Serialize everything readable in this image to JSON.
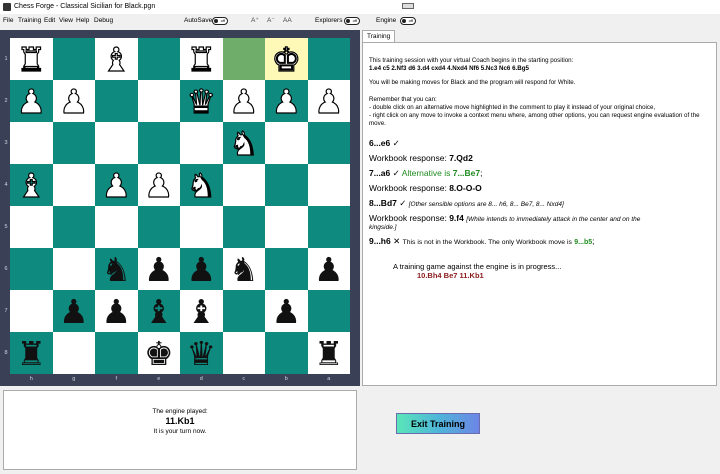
{
  "window": {
    "title": "Chess Forge - Classical Sicilian for Black.pgn"
  },
  "menu": {
    "items": [
      "File",
      "Training",
      "Edit",
      "View",
      "Help",
      "Debug"
    ],
    "autosave_label": "AutoSave",
    "autosave_state": "off",
    "font_buttons": [
      "A⁺",
      "A⁻",
      "AA"
    ],
    "explorers_label": "Explorers",
    "explorers_state": "off",
    "engine_label": "Engine",
    "engine_state": "off"
  },
  "board": {
    "files": [
      "h",
      "g",
      "f",
      "e",
      "d",
      "c",
      "b",
      "a"
    ],
    "ranks": [
      "1",
      "2",
      "3",
      "4",
      "5",
      "6",
      "7",
      "8"
    ],
    "light_color": "#ffffff",
    "dark_color": "#0f8a7e",
    "last_move_from_color": "#6fae6a",
    "last_move_to_color": "#fff9b8",
    "pieces": [
      {
        "file": "h",
        "rank": 1,
        "piece": "rook",
        "color": "white",
        "glyph": "♜"
      },
      {
        "file": "f",
        "rank": 1,
        "piece": "bishop",
        "color": "white",
        "glyph": "♝"
      },
      {
        "file": "d",
        "rank": 1,
        "piece": "rook",
        "color": "white",
        "glyph": "♜"
      },
      {
        "file": "b",
        "rank": 1,
        "piece": "king",
        "color": "white",
        "glyph": "♚"
      },
      {
        "file": "h",
        "rank": 2,
        "piece": "pawn",
        "color": "white",
        "glyph": "♟"
      },
      {
        "file": "g",
        "rank": 2,
        "piece": "pawn",
        "color": "white",
        "glyph": "♟"
      },
      {
        "file": "d",
        "rank": 2,
        "piece": "queen",
        "color": "white",
        "glyph": "♛"
      },
      {
        "file": "c",
        "rank": 2,
        "piece": "pawn",
        "color": "white",
        "glyph": "♟"
      },
      {
        "file": "b",
        "rank": 2,
        "piece": "pawn",
        "color": "white",
        "glyph": "♟"
      },
      {
        "file": "a",
        "rank": 2,
        "piece": "pawn",
        "color": "white",
        "glyph": "♟"
      },
      {
        "file": "c",
        "rank": 3,
        "piece": "knight",
        "color": "white",
        "glyph": "♞"
      },
      {
        "file": "h",
        "rank": 4,
        "piece": "bishop",
        "color": "white",
        "glyph": "♝"
      },
      {
        "file": "f",
        "rank": 4,
        "piece": "pawn",
        "color": "white",
        "glyph": "♟"
      },
      {
        "file": "e",
        "rank": 4,
        "piece": "pawn",
        "color": "white",
        "glyph": "♟"
      },
      {
        "file": "d",
        "rank": 4,
        "piece": "knight",
        "color": "white",
        "glyph": "♞"
      },
      {
        "file": "f",
        "rank": 6,
        "piece": "knight",
        "color": "black",
        "glyph": "♞"
      },
      {
        "file": "e",
        "rank": 6,
        "piece": "pawn",
        "color": "black",
        "glyph": "♟"
      },
      {
        "file": "d",
        "rank": 6,
        "piece": "pawn",
        "color": "black",
        "glyph": "♟"
      },
      {
        "file": "c",
        "rank": 6,
        "piece": "knight",
        "color": "black",
        "glyph": "♞"
      },
      {
        "file": "a",
        "rank": 6,
        "piece": "pawn",
        "color": "black",
        "glyph": "♟"
      },
      {
        "file": "g",
        "rank": 7,
        "piece": "pawn",
        "color": "black",
        "glyph": "♟"
      },
      {
        "file": "f",
        "rank": 7,
        "piece": "pawn",
        "color": "black",
        "glyph": "♟"
      },
      {
        "file": "e",
        "rank": 7,
        "piece": "bishop",
        "color": "black",
        "glyph": "♝"
      },
      {
        "file": "d",
        "rank": 7,
        "piece": "bishop",
        "color": "black",
        "glyph": "♝"
      },
      {
        "file": "b",
        "rank": 7,
        "piece": "pawn",
        "color": "black",
        "glyph": "♟"
      },
      {
        "file": "h",
        "rank": 8,
        "piece": "rook",
        "color": "black",
        "glyph": "♜"
      },
      {
        "file": "e",
        "rank": 8,
        "piece": "king",
        "color": "black",
        "glyph": "♚"
      },
      {
        "file": "d",
        "rank": 8,
        "piece": "queen",
        "color": "black",
        "glyph": "♛"
      },
      {
        "file": "a",
        "rank": 8,
        "piece": "rook",
        "color": "black",
        "glyph": "♜"
      }
    ],
    "highlights": [
      {
        "file": "c",
        "rank": 1,
        "type": "from"
      },
      {
        "file": "b",
        "rank": 1,
        "type": "to"
      }
    ]
  },
  "panel": {
    "tab_label": "Training",
    "intro": "This training session with your virtual Coach begins in the starting position:",
    "opening_moves": "1.e4 c5 2.Nf3 d6 3.d4 cxd4 4.Nxd4 Nf6 5.Nc3 Nc6 6.Bg5",
    "play_info": "You will be making moves for Black and the program will respond for White.",
    "remember": "Remember that you can:",
    "tip1": "- double click on an alternative move highlighted in the comment to play it instead of your original choice,",
    "tip2": "- right click on any move to invoke a context menu where, among other options, you can request engine evaluation of the move.",
    "check_mark": "✓",
    "cross_mark": "✕",
    "lines": {
      "m6": "6...e6",
      "wb_label": "Workbook response:",
      "r7": "7.Qd2",
      "m7": "7...a6",
      "alt_text": "Alternative is",
      "alt_move": "7...Be7",
      "semicolon": ";",
      "r8": "8.O-O-O",
      "m8": "8...Bd7",
      "comment8": "[Other sensible options are 8... h6, 8... Be7, 8... Nxd4]",
      "r9": "9.f4",
      "comment9a": "[White intends to immediately attack in the center and on the",
      "comment9b": "kingside.]",
      "m9": "9...h6",
      "not_in_wb": "This is not in the Workbook. The only Workbook move is",
      "only_move": "9...b5",
      "game_progress": "A training game against the engine is in progress...",
      "engine_line": "10.Bh4 Be7 11.Kb1"
    }
  },
  "engine_box": {
    "played_label": "The engine played:",
    "move": "11.Kb1",
    "turn_text": "It is your turn now."
  },
  "exit_button": {
    "label": "Exit Training"
  }
}
